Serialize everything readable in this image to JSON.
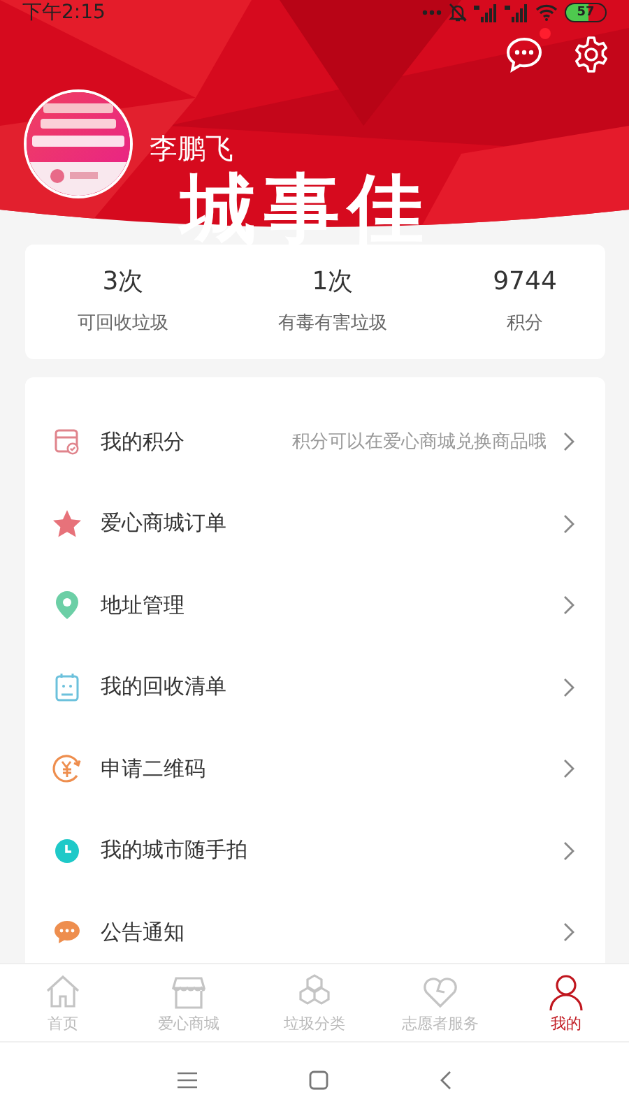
{
  "status_bar": {
    "time": "下午2:15",
    "battery": "57"
  },
  "header": {
    "messages_unread": true,
    "name": "李鹏飞",
    "banner_text": "城事佳"
  },
  "stats": [
    {
      "value": "3次",
      "label": "可回收垃圾"
    },
    {
      "value": "1次",
      "label": "有毒有害垃圾"
    },
    {
      "value": "9744",
      "label": "积分"
    }
  ],
  "menu": [
    {
      "label": "我的积分",
      "hint": "积分可以在爱心商城兑换商品哦"
    },
    {
      "label": "爱心商城订单"
    },
    {
      "label": "地址管理"
    },
    {
      "label": "我的回收清单"
    },
    {
      "label": "申请二维码"
    },
    {
      "label": "我的城市随手拍"
    },
    {
      "label": "公告通知"
    }
  ],
  "tabs": [
    {
      "label": "首页",
      "selected": false
    },
    {
      "label": "爱心商城",
      "selected": false
    },
    {
      "label": "垃圾分类",
      "selected": false
    },
    {
      "label": "志愿者服务",
      "selected": false
    },
    {
      "label": "我的",
      "selected": true
    }
  ]
}
